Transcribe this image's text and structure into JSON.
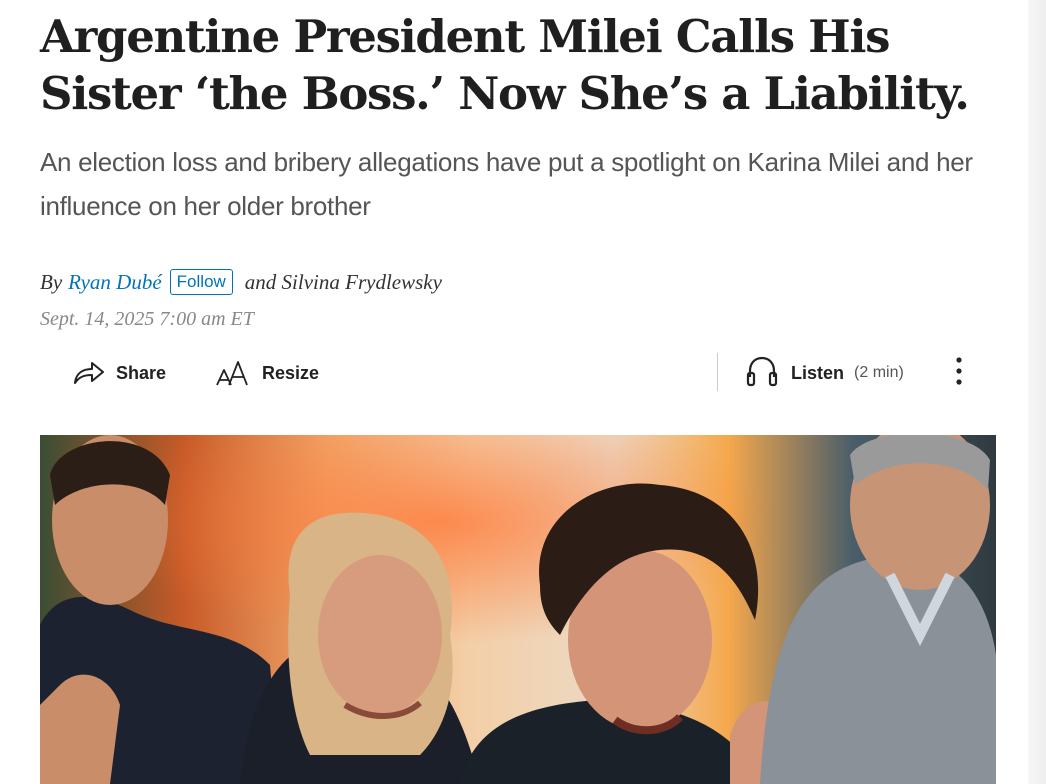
{
  "article": {
    "headline": "Argentine President Milei Calls His Sister ‘the Boss.’ Now She’s a Liability.",
    "dek": "An election loss and bribery allegations have put a spotlight on Karina Milei and her influence on her older brother",
    "byline": {
      "prefix": "By",
      "author1": "Ryan Dubé",
      "follow_label": "Follow",
      "and_text": "and Silvina Frydlewsky"
    },
    "dateline": "Sept. 14, 2025 7:00 am ET"
  },
  "toolbar": {
    "share_label": "Share",
    "resize_label": "Resize",
    "listen_label": "Listen",
    "listen_duration": "(2 min)",
    "icons": {
      "share": "share-arrow-icon",
      "resize": "text-resize-icon",
      "listen": "headphones-icon",
      "more": "vertical-ellipsis-icon"
    }
  },
  "colors": {
    "link": "#0274b6",
    "headline": "#1f1f1f",
    "dek": "#555555",
    "dateline": "#888888"
  }
}
